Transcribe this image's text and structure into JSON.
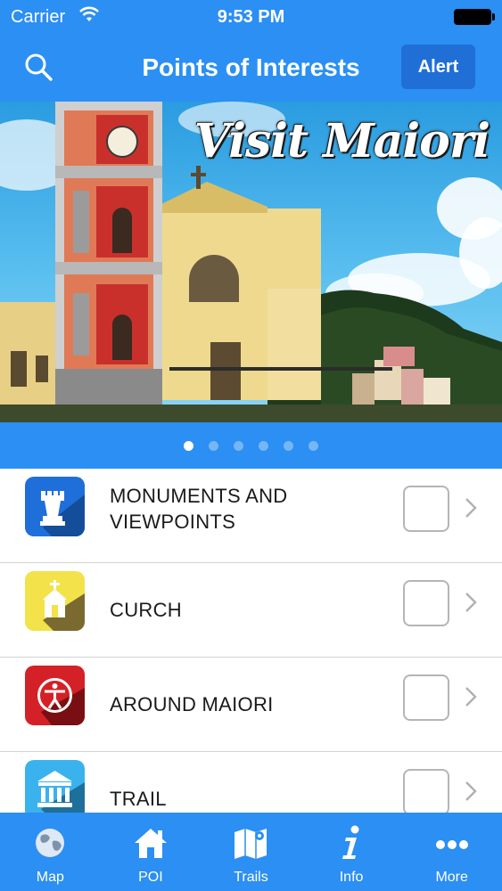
{
  "status_bar": {
    "carrier": "Carrier",
    "time": "9:53 PM"
  },
  "header": {
    "title": "Points of Interests",
    "alert_label": "Alert"
  },
  "banner": {
    "title": "Visit Maiori",
    "slide_count": 6,
    "active_slide": 1
  },
  "categories": [
    {
      "label_line1": "MONUMENTS AND",
      "label_line2": "VIEWPOINTS",
      "icon": "castle-tower-icon",
      "color": "#1e6fd9",
      "checked": false
    },
    {
      "label": "CURCH",
      "icon": "church-icon",
      "color": "#f3e24a",
      "checked": false
    },
    {
      "label": "AROUND MAIORI",
      "icon": "person-circle-icon",
      "color": "#d42127",
      "checked": false
    },
    {
      "label": "TRAIL",
      "icon": "building-columns-icon",
      "color": "#3ab2ee",
      "checked": false
    }
  ],
  "tabbar": {
    "items": [
      {
        "label": "Map",
        "icon": "globe-icon"
      },
      {
        "label": "POI",
        "icon": "house-icon"
      },
      {
        "label": "Trails",
        "icon": "folded-map-icon"
      },
      {
        "label": "Info",
        "icon": "info-icon"
      },
      {
        "label": "More",
        "icon": "more-dots-icon"
      }
    ]
  },
  "colors": {
    "primary": "#2b8ff3",
    "alert_button": "#1f6fd6"
  }
}
